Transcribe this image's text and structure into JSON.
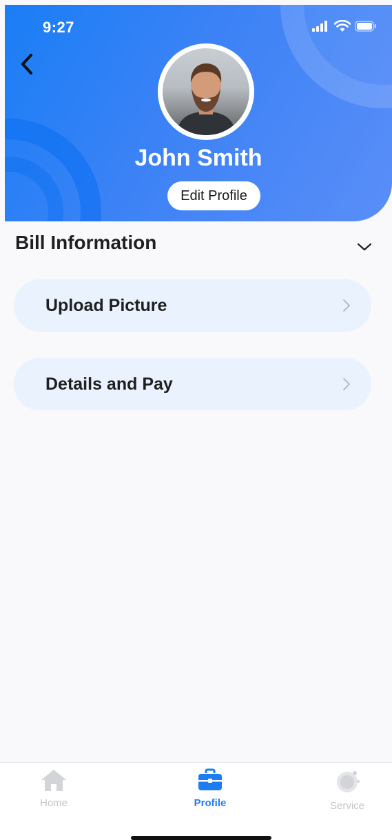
{
  "status_bar": {
    "time": "9:27"
  },
  "profile": {
    "name": "John Smith",
    "edit_label": "Edit Profile"
  },
  "section": {
    "title": "Bill Information",
    "items": [
      {
        "label": "Upload Picture"
      },
      {
        "label": "Details and Pay"
      }
    ]
  },
  "tabbar": {
    "active": "Profile",
    "tabs": [
      {
        "label": "Home",
        "icon": "home-icon"
      },
      {
        "label": "Profile",
        "icon": "briefcase-icon"
      },
      {
        "label": "Service",
        "icon": "service-icon"
      }
    ]
  },
  "colors": {
    "accent": "#1e7cf2",
    "header_gradient_start": "#1a7ef5",
    "item_background": "#e9f2fd",
    "inactive_tab": "#c4c4c8"
  }
}
